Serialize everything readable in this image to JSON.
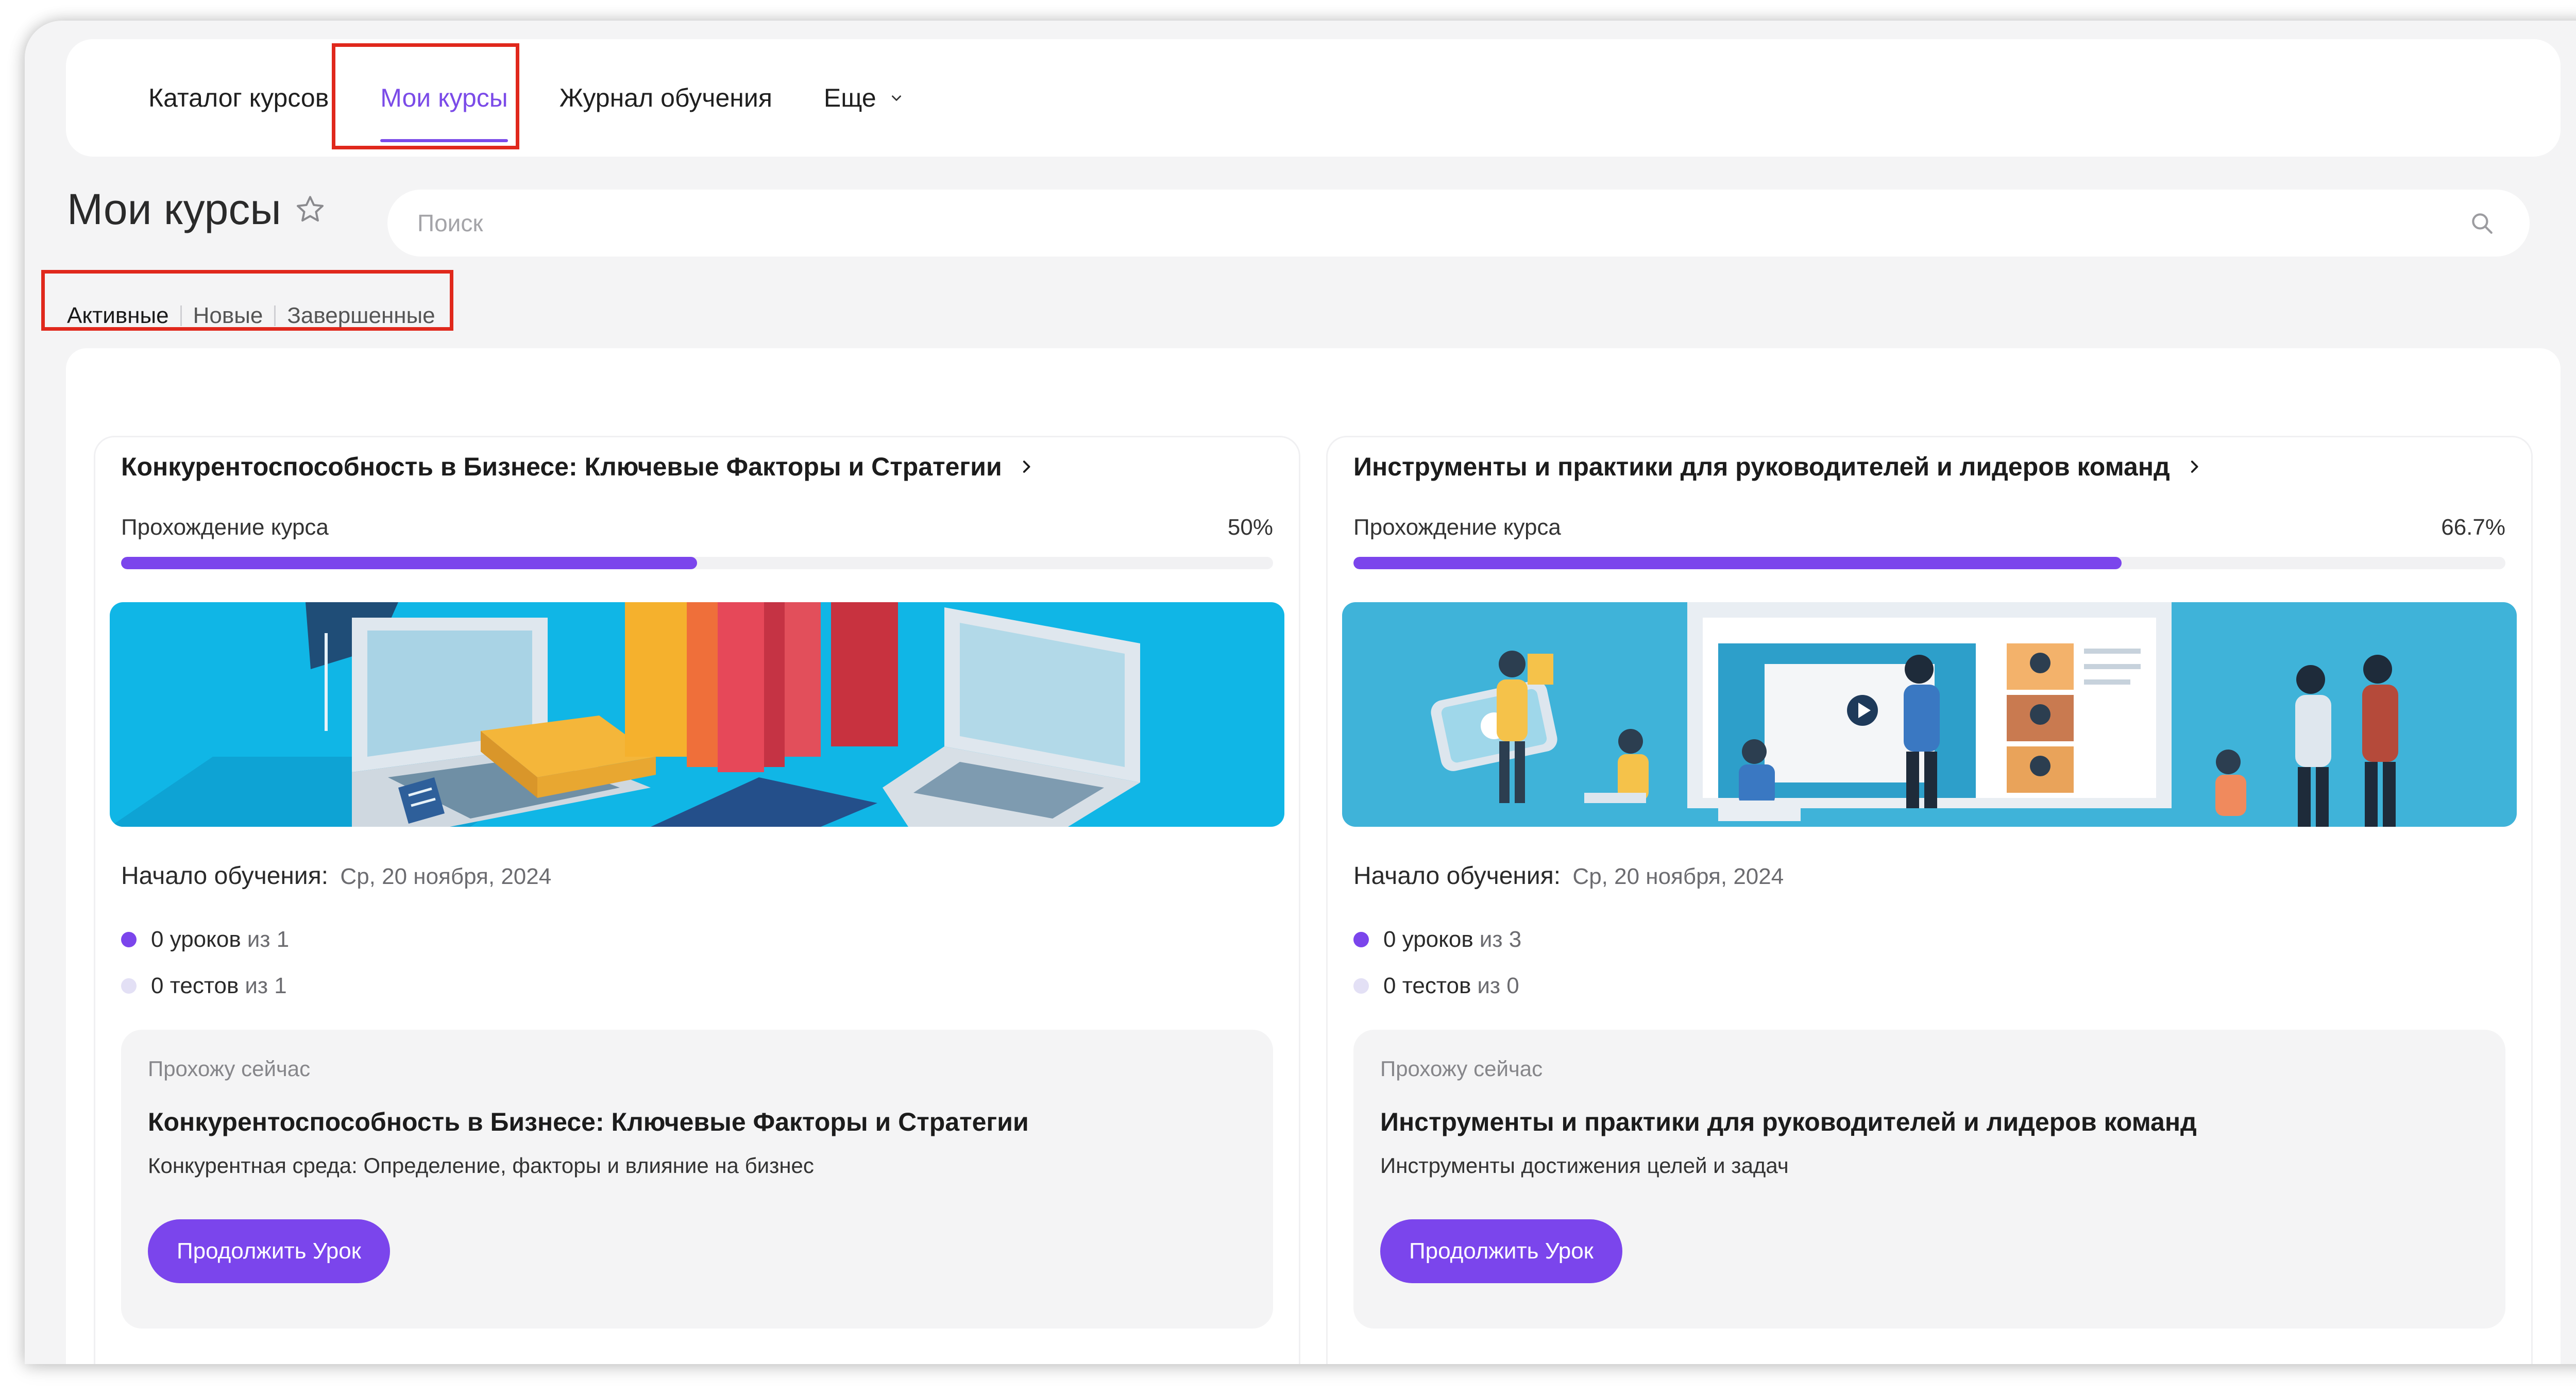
{
  "nav": {
    "items": [
      {
        "label": "Каталог курсов",
        "active": false
      },
      {
        "label": "Мои курсы",
        "active": true
      },
      {
        "label": "Журнал обучения",
        "active": false
      },
      {
        "label": "Еще",
        "active": false,
        "has_dropdown": true
      }
    ]
  },
  "page": {
    "title": "Мои курсы",
    "favorite_icon": "star-outline-icon"
  },
  "search": {
    "placeholder": "Поиск",
    "value": "",
    "icon": "search-icon"
  },
  "filters": [
    {
      "label": "Активные",
      "active": true
    },
    {
      "label": "Новые",
      "active": false
    },
    {
      "label": "Завершенные",
      "active": false
    }
  ],
  "courses": [
    {
      "title": "Конкурентоспособность в Бизнесе: Ключевые Факторы и Стратегии",
      "progress_label": "Прохождение курса",
      "progress_text": "50%",
      "progress_percent": 50,
      "start_label": "Начало обучения:",
      "start_date": "Ср, 20 ноября, 2024",
      "lessons_count": "0 уроков",
      "lessons_total": "из 1",
      "tests_count": "0 тестов",
      "tests_total": "из 1",
      "current_caption": "Прохожу сейчас",
      "current_title": "Конкурентоспособность в Бизнесе: Ключевые Факторы и Стратегии",
      "current_lesson": "Конкурентная среда: Определение, факторы и влияние на бизнес",
      "button_label": "Продолжить Урок",
      "banner": "education-isometric-illustration"
    },
    {
      "title": "Инструменты и практики для руководителей и лидеров команд",
      "progress_label": "Прохождение курса",
      "progress_text": "66.7%",
      "progress_percent": 66.7,
      "start_label": "Начало обучения:",
      "start_date": "Ср, 20 ноября, 2024",
      "lessons_count": "0 уроков",
      "lessons_total": "из 3",
      "tests_count": "0 тестов",
      "tests_total": "из 0",
      "current_caption": "Прохожу сейчас",
      "current_title": "Инструменты и практики для руководителей и лидеров команд",
      "current_lesson": "Инструменты достижения целей и задач",
      "button_label": "Продолжить Урок",
      "banner": "online-meeting-illustration"
    }
  ],
  "colors": {
    "accent": "#7b45ec",
    "nav_active": "#7b4be8",
    "highlight": "#e0281c",
    "background": "#f4f4f5",
    "lessons_dot": "#7b45ec",
    "tests_dot": "#e3e0f5"
  }
}
